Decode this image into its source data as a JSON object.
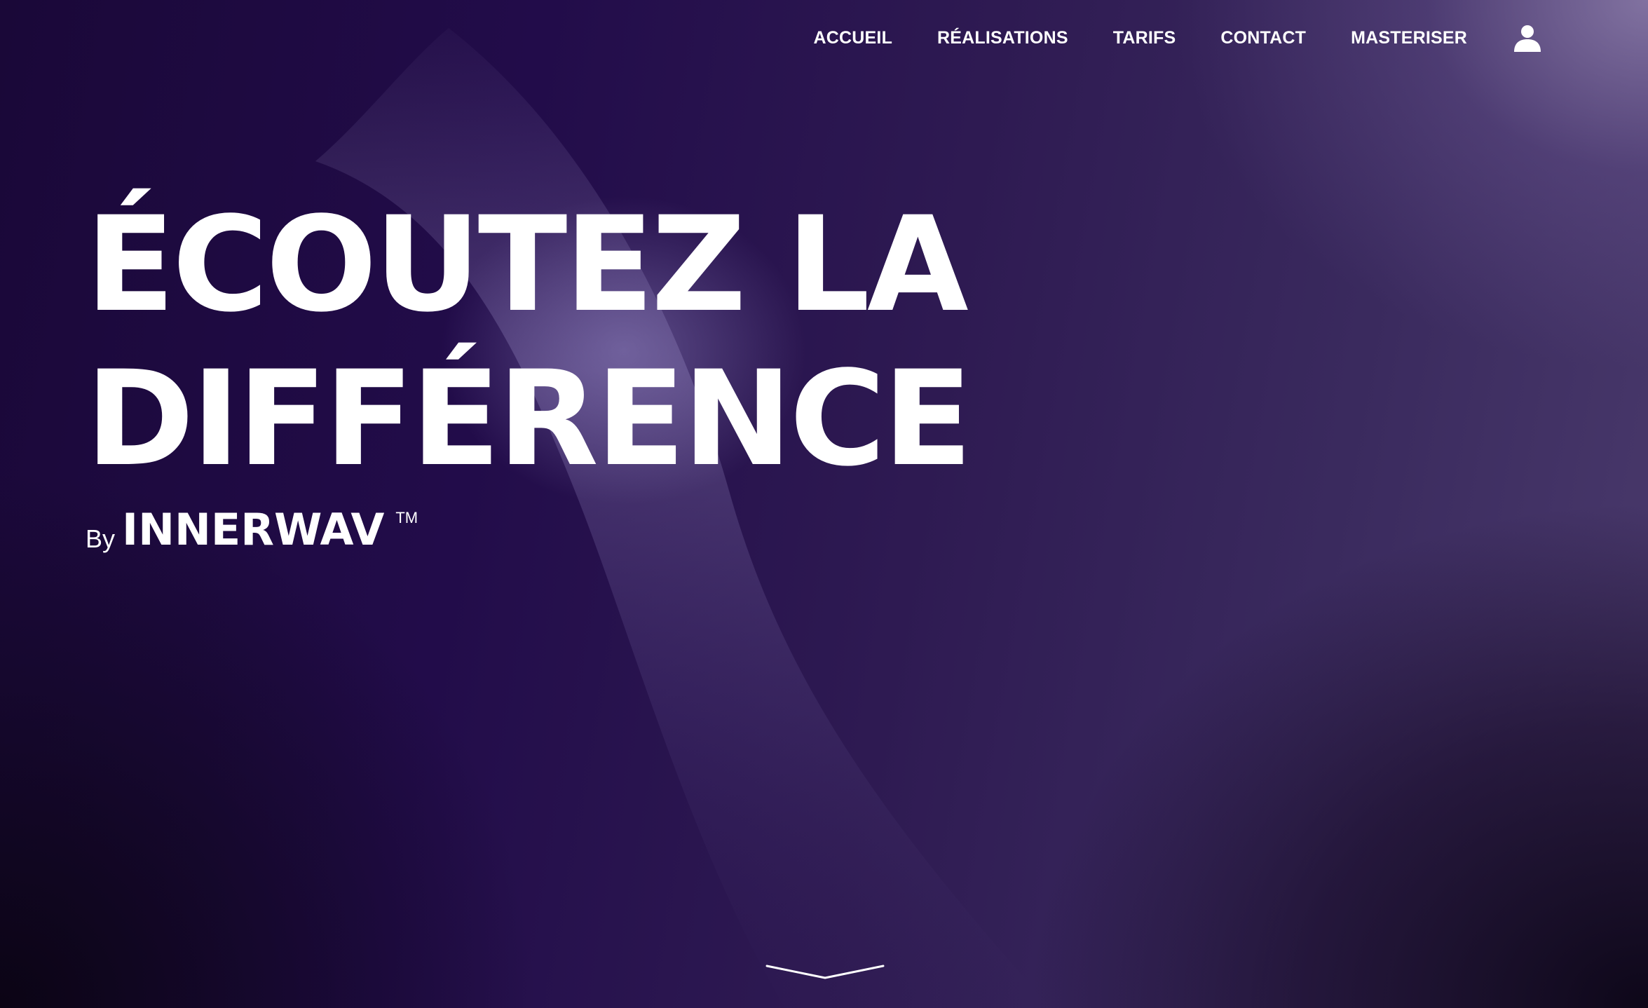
{
  "nav": {
    "items": [
      {
        "label": "ACCUEIL"
      },
      {
        "label": "RÉALISATIONS"
      },
      {
        "label": "TARIFS"
      },
      {
        "label": "CONTACT"
      },
      {
        "label": "MASTERISER"
      }
    ],
    "account_icon": "user-icon"
  },
  "hero": {
    "headline_line1": "ÉCOUTEZ LA",
    "headline_line2": "DIFFÉRENCE",
    "by_label": "By",
    "brand": "INNERWAV",
    "trademark": "TM"
  },
  "scroll_icon": "chevron-down-icon",
  "colors": {
    "background_dark": "#1a0838",
    "background_light": "#5a4a78",
    "text": "#ffffff"
  }
}
